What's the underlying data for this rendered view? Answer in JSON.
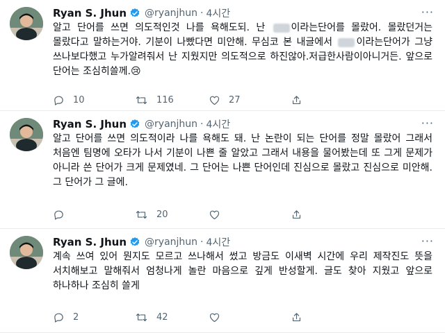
{
  "tweets": [
    {
      "name": "Ryan S. Jhun",
      "handle": "@ryanjhun",
      "time": "4시간",
      "text_parts": [
        "알고 단어를 쓰면 의도적인것 나를 욕해도되. 난 ",
        "이라는단어를 몰랐어. 몰랐던거는 몰랐다고 말하는거야. 기분이 나빴다면 미안해. 무심코 본 내글에서 ",
        "이라는단어가 그냥 쓰나보다했고 누가알려줘서 난 지웠지만 의도적으로 하진않아.저급한사람이아니거든. 앞으로 단어는 조심히쓸께."
      ],
      "emoji": "😢",
      "replies": "10",
      "retweets": "116",
      "likes": "27"
    },
    {
      "name": "Ryan S. Jhun",
      "handle": "@ryanjhun",
      "time": "4시간",
      "text": "알고 단어를 쓰면 의도적이라 나를 욕해도 돼. 난 논란이 되는 단어를 정말 몰랐어 그래서 처음엔 팀명에 오타가 나서 기분이 나쁜 줄 알았고 그래서 내용을 물어봤는데 또 그게 문제가 아니라 쓴 단어가 크게 문제였네. 그 단어는 나쁜 단어인데 진심으로 몰랐고 진심으로 미안해. 그 단어가 그 글에.",
      "replies": "",
      "retweets": "20",
      "likes": ""
    },
    {
      "name": "Ryan S. Jhun",
      "handle": "@ryanjhun",
      "time": "4시간",
      "text": "계속 쓰여 있어 뭔지도 모르고 쓰나해서 썼고 방금도 이새벽 시간에 우리 제작진도 뜻을 서치해보고 말해줘서 엄청나게 놀란 마음으로 깊게 반성할게. 글도 찾아 지웠고 앞으로 하나하나 조심히 쓸게",
      "replies": "2",
      "retweets": "42",
      "likes": ""
    }
  ],
  "icons": {
    "verified": "verified-badge-icon",
    "more": "more-options-icon",
    "reply": "reply-icon",
    "retweet": "retweet-icon",
    "like": "heart-icon",
    "share": "share-icon"
  },
  "colors": {
    "verified": "#1d9bf0",
    "secondary_text": "#536471",
    "divider": "#e6ecf0"
  }
}
